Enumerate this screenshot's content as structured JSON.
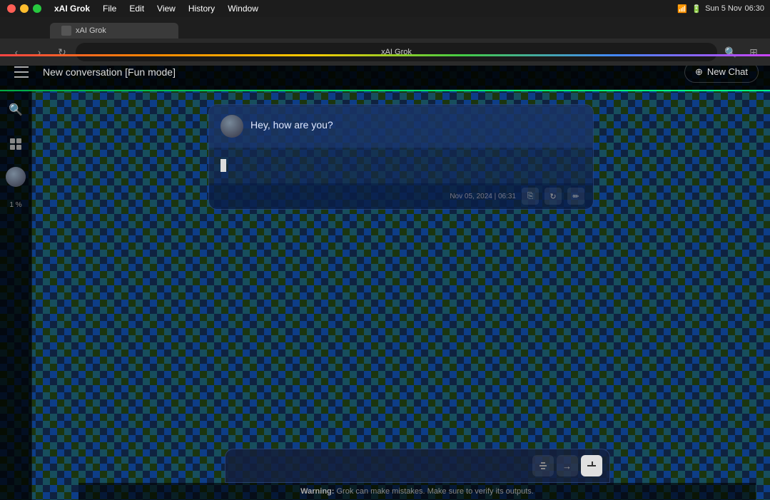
{
  "macos": {
    "menu": {
      "appName": "xAI Grok",
      "items": [
        "File",
        "Edit",
        "View",
        "History",
        "Window"
      ],
      "rightItems": [
        "Sun 5 Nov",
        "06:30"
      ]
    },
    "browser": {
      "tab_title": "xAI Grok",
      "address": "xAI Grok"
    }
  },
  "app": {
    "header": {
      "conversation_title": "New conversation [Fun mode]",
      "new_chat_button": "New Chat"
    },
    "sidebar": {
      "search_icon": "🔍",
      "panels_icon": "⊞",
      "percent_label": "1 %"
    },
    "chat": {
      "user_message": "Hey, how are you?",
      "timestamp": "Nov 05, 2024 | 06:31",
      "action_buttons": [
        "copy",
        "refresh",
        "edit"
      ]
    },
    "input": {
      "placeholder": "",
      "action_icons": [
        "attach",
        "arrow-right",
        "return"
      ]
    },
    "warning": {
      "prefix": "Warning:",
      "text": "Grok can make mistakes. Make sure to verify its outputs."
    }
  },
  "colors": {
    "accent_green": "#00cc66",
    "bg_dark": "#0a0f1a",
    "bubble_bg": "rgba(20,40,80,0.7)",
    "user_msg_bg": "rgba(30,60,120,0.5)"
  }
}
